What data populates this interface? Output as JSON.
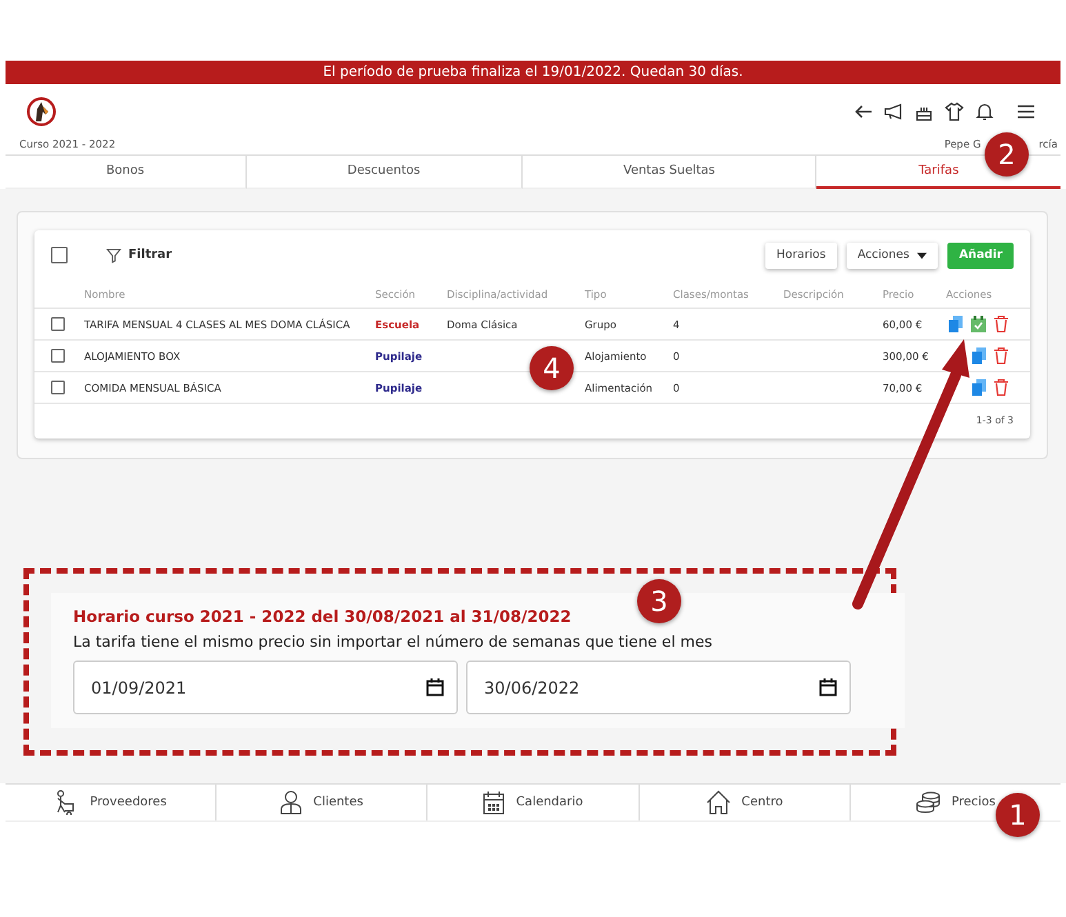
{
  "trial_banner": "El período de prueba finaliza el 19/01/2022. Quedan 30 días.",
  "header": {
    "course": "Curso 2021 - 2022",
    "user_visible_parts": [
      "Pepe G",
      "rcía"
    ]
  },
  "tabs": [
    {
      "label": "Bonos",
      "selected": false
    },
    {
      "label": "Descuentos",
      "selected": false
    },
    {
      "label": "Ventas Sueltas",
      "selected": false
    },
    {
      "label": "Tarifas",
      "selected": true
    }
  ],
  "table": {
    "select_all": {
      "checked": false
    },
    "filter_label": "Filtrar",
    "buttons": [
      {
        "label": "Horarios",
        "kind": "plain"
      },
      {
        "label": "Acciones",
        "kind": "dropdown"
      },
      {
        "label": "Añadir",
        "kind": "primary"
      }
    ],
    "columns": [
      "Nombre",
      "Sección",
      "Disciplina/actividad",
      "Tipo",
      "Clases/montas",
      "Descripción",
      "Precio",
      "Acciones"
    ],
    "rows": [
      {
        "checked": false,
        "name": "TARIFA MENSUAL 4 CLASES AL MES DOMA CLÁSICA",
        "section": "Escuela",
        "color": "#c62828",
        "discipline": "Doma Clásica",
        "type": "Grupo",
        "classes": "4",
        "price": "60,00 €",
        "schedule_action": true
      },
      {
        "checked": false,
        "name": "ALOJAMIENTO BOX",
        "section": "Pupilaje",
        "color": "#2e2a8c",
        "type": "Alojamiento",
        "classes": "0",
        "price": "300,00 €",
        "schedule_action": false
      },
      {
        "checked": false,
        "name": "COMIDA MENSUAL BÁSICA",
        "section": "Pupilaje",
        "color": "#2e2a8c",
        "type": "Alimentación",
        "classes": "0",
        "price": "70,00 €",
        "schedule_action": false
      }
    ],
    "pagination": "1-3 of 3"
  },
  "schedule": {
    "title": "Horario curso 2021 - 2022 del 30/08/2021 al 31/08/2022",
    "note": "La tarifa tiene el mismo precio sin importar el número de semanas que tiene el mes",
    "start_date": "01/09/2021",
    "end_date": "30/06/2022"
  },
  "bottom_nav": [
    {
      "label": "Proveedores"
    },
    {
      "label": "Clientes"
    },
    {
      "label": "Calendario"
    },
    {
      "label": "Centro"
    },
    {
      "label": "Precios"
    }
  ],
  "callouts": [
    "1",
    "2",
    "3",
    "4"
  ]
}
